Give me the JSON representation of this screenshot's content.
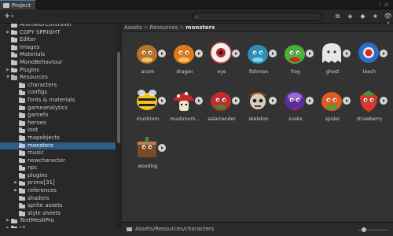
{
  "window": {
    "tab_title": "Project",
    "menu_glyph": "⋮ ▫"
  },
  "toolbar": {
    "add_label": "+",
    "add_caret": "▾",
    "search_placeholder": "",
    "icons": [
      {
        "name": "scene-filter-icon",
        "glyph": "⧉"
      },
      {
        "name": "type-filter-icon",
        "glyph": "◈"
      },
      {
        "name": "label-filter-icon",
        "glyph": "◆"
      },
      {
        "name": "favorite-icon",
        "glyph": "★"
      },
      {
        "name": "hidden-count-icon",
        "glyph": "👁4"
      }
    ]
  },
  "tree": {
    "items": [
      {
        "label": "AnimatorController",
        "indent": 1,
        "arrow": "",
        "selected": false,
        "open": false
      },
      {
        "label": "COPY SPRIGHT",
        "indent": 1,
        "arrow": "▶",
        "selected": false,
        "open": false
      },
      {
        "label": "Editor",
        "indent": 1,
        "arrow": "",
        "selected": false,
        "open": false
      },
      {
        "label": "Images",
        "indent": 1,
        "arrow": "",
        "selected": false,
        "open": false
      },
      {
        "label": "Materials",
        "indent": 1,
        "arrow": "",
        "selected": false,
        "open": false
      },
      {
        "label": "MonoBehaviour",
        "indent": 1,
        "arrow": "",
        "selected": false,
        "open": false
      },
      {
        "label": "Plugins",
        "indent": 1,
        "arrow": "▶",
        "selected": false,
        "open": false
      },
      {
        "label": "Resources",
        "indent": 1,
        "arrow": "▼",
        "selected": false,
        "open": true
      },
      {
        "label": "characters",
        "indent": 2,
        "arrow": "",
        "selected": false,
        "open": false
      },
      {
        "label": "configs",
        "indent": 2,
        "arrow": "",
        "selected": false,
        "open": false
      },
      {
        "label": "fonts & materials",
        "indent": 2,
        "arrow": "",
        "selected": false,
        "open": false
      },
      {
        "label": "gameanalytics",
        "indent": 2,
        "arrow": "",
        "selected": false,
        "open": false
      },
      {
        "label": "gamefx",
        "indent": 2,
        "arrow": "",
        "selected": false,
        "open": false
      },
      {
        "label": "heroes",
        "indent": 2,
        "arrow": "",
        "selected": false,
        "open": false
      },
      {
        "label": "loot",
        "indent": 2,
        "arrow": "",
        "selected": false,
        "open": false
      },
      {
        "label": "mapobjects",
        "indent": 2,
        "arrow": "",
        "selected": false,
        "open": false
      },
      {
        "label": "monsters",
        "indent": 2,
        "arrow": "",
        "selected": true,
        "open": false
      },
      {
        "label": "music",
        "indent": 2,
        "arrow": "",
        "selected": false,
        "open": false
      },
      {
        "label": "newcharacter",
        "indent": 2,
        "arrow": "",
        "selected": false,
        "open": false
      },
      {
        "label": "npc",
        "indent": 2,
        "arrow": "",
        "selected": false,
        "open": false
      },
      {
        "label": "plugins",
        "indent": 2,
        "arrow": "",
        "selected": false,
        "open": false
      },
      {
        "label": "prime[31]",
        "indent": 2,
        "arrow": "▶",
        "selected": false,
        "open": false
      },
      {
        "label": "references",
        "indent": 2,
        "arrow": "▶",
        "selected": false,
        "open": false
      },
      {
        "label": "shaders",
        "indent": 2,
        "arrow": "",
        "selected": false,
        "open": false
      },
      {
        "label": "sprite assets",
        "indent": 2,
        "arrow": "",
        "selected": false,
        "open": false
      },
      {
        "label": "style sheets",
        "indent": 2,
        "arrow": "",
        "selected": false,
        "open": false
      },
      {
        "label": "TextMeshPro",
        "indent": 1,
        "arrow": "▶",
        "selected": false,
        "open": false
      },
      {
        "label": "UI",
        "indent": 1,
        "arrow": "▶",
        "selected": false,
        "open": false
      }
    ]
  },
  "breadcrumb": {
    "items": [
      "Assets",
      "Resources",
      "monsters"
    ],
    "separator": ">",
    "menu_glyph": "▾"
  },
  "assets": [
    {
      "label": "acorn",
      "icon": "acorn-icon",
      "color": "#b8742a",
      "accent": "#f0c36a"
    },
    {
      "label": "dragon",
      "icon": "dragon-icon",
      "color": "#e07a1c",
      "accent": "#f6c067"
    },
    {
      "label": "eye",
      "icon": "eye-icon",
      "color": "#f2f2f2",
      "accent": "#c0252b"
    },
    {
      "label": "fishman",
      "icon": "fishman-icon",
      "color": "#2b8fb8",
      "accent": "#7fd3ea"
    },
    {
      "label": "frog",
      "icon": "frog-icon",
      "color": "#4caf3a",
      "accent": "#c72b2b"
    },
    {
      "label": "ghost",
      "icon": "ghost-icon",
      "color": "#e6e6e6",
      "accent": "#9a9a9a"
    },
    {
      "label": "leech",
      "icon": "leech-icon",
      "color": "#2a6cc6",
      "accent": "#d62a2a"
    },
    {
      "label": "mushrom",
      "icon": "bee-icon",
      "color": "#f0c419",
      "accent": "#1e1e1e"
    },
    {
      "label": "mushroom...",
      "icon": "mushroom-icon",
      "color": "#c62828",
      "accent": "#f3f3f3"
    },
    {
      "label": "salamander",
      "icon": "salamander-icon",
      "color": "#c12b2b",
      "accent": "#3b8a2e"
    },
    {
      "label": "skeleton",
      "icon": "skeleton-icon",
      "color": "#d9cdb8",
      "accent": "#8c4a2a"
    },
    {
      "label": "snake",
      "icon": "snake-icon",
      "color": "#5b2d9c",
      "accent": "#9b6ad4"
    },
    {
      "label": "spider",
      "icon": "spider-icon",
      "color": "#e05a22",
      "accent": "#3da33a"
    },
    {
      "label": "strawberry",
      "icon": "strawberry-icon",
      "color": "#d9382e",
      "accent": "#3d9b35"
    },
    {
      "label": "woodlog",
      "icon": "woodlog-icon",
      "color": "#7a4a26",
      "accent": "#b8824e"
    }
  ],
  "status": {
    "path": "Assets/Resources/characters"
  }
}
